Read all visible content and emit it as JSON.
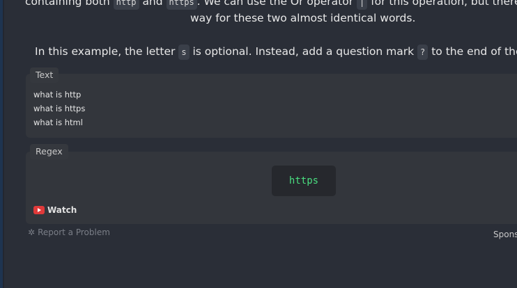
{
  "intro": {
    "line1_part1": "containing both",
    "code1": "http",
    "line1_part2": "and",
    "code2": "https",
    "line1_part3": ". We can use the Or operator",
    "code3": "|",
    "line1_part4": "for this operation, but there",
    "line2": "way for these two almost identical words."
  },
  "example": {
    "part1": "In this example, the letter",
    "code_s": "s",
    "part2": "is optional. Instead, add a question mark",
    "code_q": "?",
    "part3": "to the end of the"
  },
  "text_panel": {
    "tab_label": "Text",
    "lines": [
      "what is http",
      "what is https",
      "what is html"
    ]
  },
  "regex_panel": {
    "tab_label": "Regex",
    "value": "https",
    "watch_label": "Watch"
  },
  "footer": {
    "report_label": "Report a Problem",
    "sponsor_label": "Spons"
  },
  "colors": {
    "background": "#2a2e37",
    "panel": "#33363c",
    "regex_text": "#4ade80",
    "youtube_red": "#e03a3a"
  },
  "icons": [
    "youtube-icon",
    "bug-icon"
  ]
}
